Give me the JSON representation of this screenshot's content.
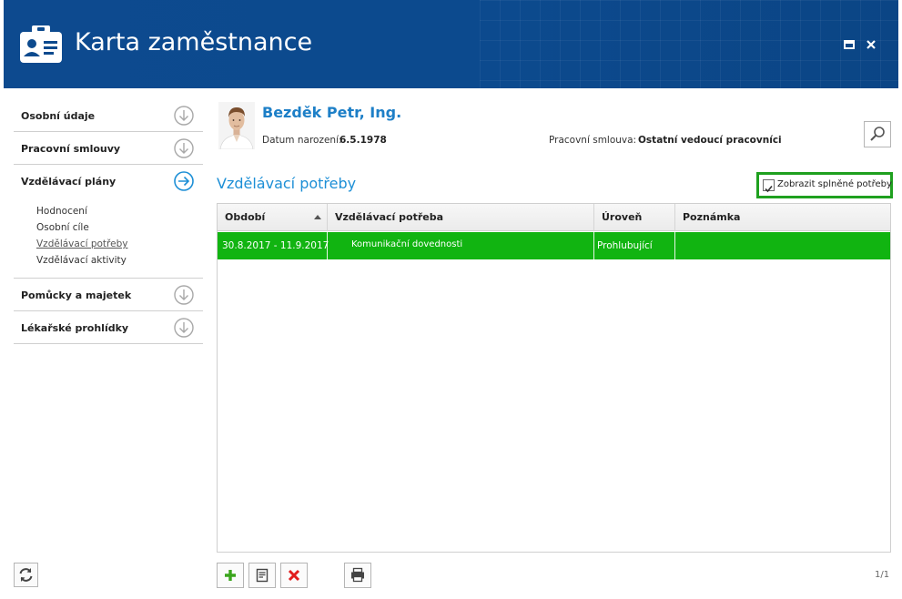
{
  "window": {
    "title": "Karta zaměstnance",
    "maximize_icon": "maximize-icon",
    "close_icon": "close-icon"
  },
  "sidebar": {
    "sections": [
      {
        "label": "Osobní údaje",
        "icon": "arrow-down-circle-icon",
        "expanded": false
      },
      {
        "label": "Pracovní smlouvy",
        "icon": "arrow-down-circle-icon",
        "expanded": false
      },
      {
        "label": "Vzdělávací plány",
        "icon": "arrow-right-circle-icon",
        "expanded": true,
        "items": [
          "Hodnocení",
          "Osobní cíle",
          "Vzdělávací potřeby",
          "Vzdělávací aktivity"
        ],
        "active_item": "Vzdělávací potřeby"
      },
      {
        "label": "Pomůcky a majetek",
        "icon": "arrow-down-circle-icon",
        "expanded": false
      },
      {
        "label": "Lékařské prohlídky",
        "icon": "arrow-down-circle-icon",
        "expanded": false
      }
    ],
    "refresh_icon": "refresh-icon"
  },
  "person": {
    "name": "Bezděk Petr, Ing.",
    "birth_label": "Datum narození:",
    "birth_date": "6.5.1978",
    "contract_label": "Pracovní smlouva:",
    "contract_value": "Ostatní vedoucí pracovníci"
  },
  "section": {
    "title": "Vzdělávací potřeby",
    "show_done_label": "Zobrazit splněné potřeby",
    "show_done_checked": true
  },
  "grid": {
    "columns": [
      "Období",
      "Vzdělávací potřeba",
      "Úroveň",
      "Poznámka"
    ],
    "rows": [
      {
        "period": "30.8.2017 - 11.9.2017",
        "need": "Komunikační dovednosti",
        "level": "Prohlubující",
        "note": ""
      }
    ],
    "selected_row_color": "#11b411"
  },
  "toolbar": {
    "buttons": [
      "add-icon",
      "edit-icon",
      "delete-icon",
      "print-icon"
    ],
    "page_info": "1/1"
  },
  "colors": {
    "header_bg": "#0c4a8e",
    "accent_blue": "#1d8fd6",
    "highlight_green": "#1fa01f"
  }
}
